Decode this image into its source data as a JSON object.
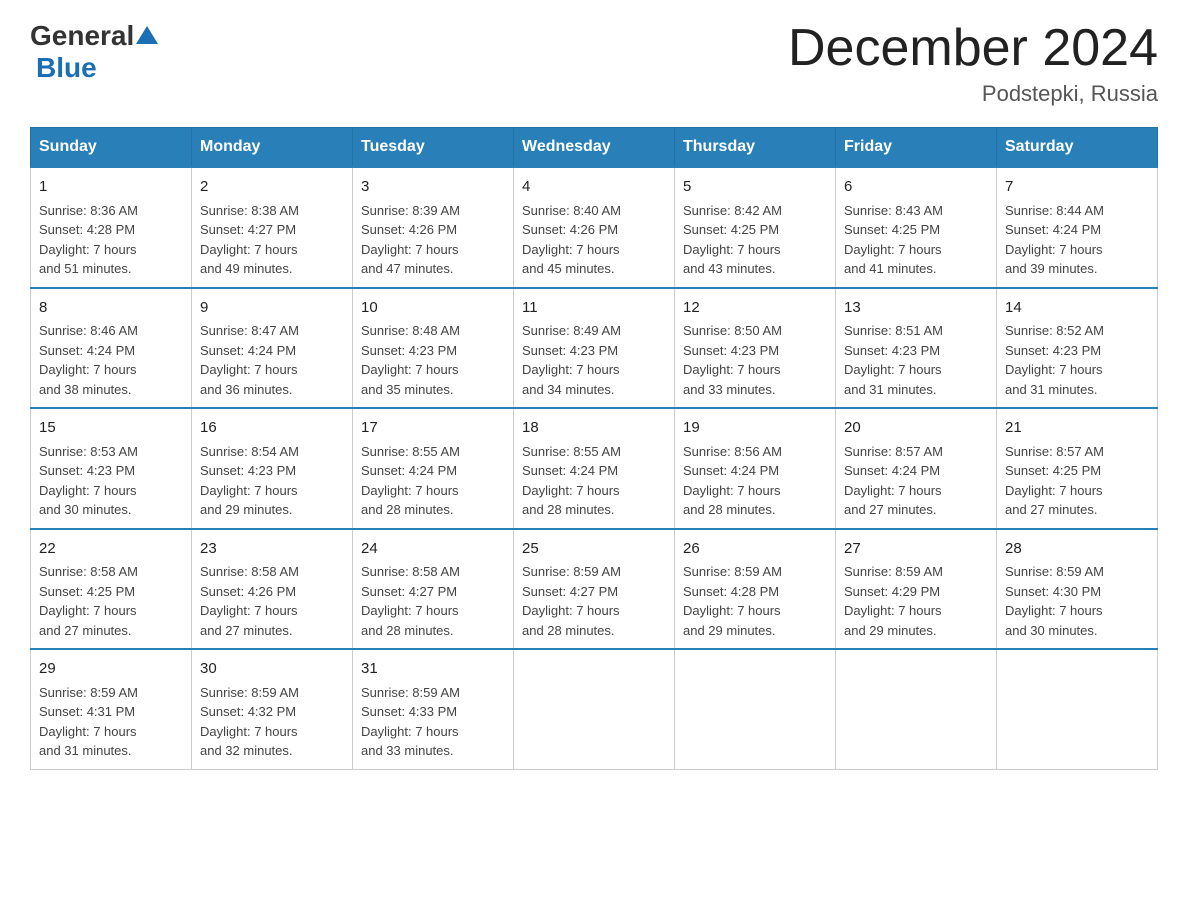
{
  "header": {
    "logo_general": "General",
    "logo_blue": "Blue",
    "month_title": "December 2024",
    "location": "Podstepki, Russia"
  },
  "days_of_week": [
    "Sunday",
    "Monday",
    "Tuesday",
    "Wednesday",
    "Thursday",
    "Friday",
    "Saturday"
  ],
  "weeks": [
    [
      {
        "num": "1",
        "info": "Sunrise: 8:36 AM\nSunset: 4:28 PM\nDaylight: 7 hours\nand 51 minutes."
      },
      {
        "num": "2",
        "info": "Sunrise: 8:38 AM\nSunset: 4:27 PM\nDaylight: 7 hours\nand 49 minutes."
      },
      {
        "num": "3",
        "info": "Sunrise: 8:39 AM\nSunset: 4:26 PM\nDaylight: 7 hours\nand 47 minutes."
      },
      {
        "num": "4",
        "info": "Sunrise: 8:40 AM\nSunset: 4:26 PM\nDaylight: 7 hours\nand 45 minutes."
      },
      {
        "num": "5",
        "info": "Sunrise: 8:42 AM\nSunset: 4:25 PM\nDaylight: 7 hours\nand 43 minutes."
      },
      {
        "num": "6",
        "info": "Sunrise: 8:43 AM\nSunset: 4:25 PM\nDaylight: 7 hours\nand 41 minutes."
      },
      {
        "num": "7",
        "info": "Sunrise: 8:44 AM\nSunset: 4:24 PM\nDaylight: 7 hours\nand 39 minutes."
      }
    ],
    [
      {
        "num": "8",
        "info": "Sunrise: 8:46 AM\nSunset: 4:24 PM\nDaylight: 7 hours\nand 38 minutes."
      },
      {
        "num": "9",
        "info": "Sunrise: 8:47 AM\nSunset: 4:24 PM\nDaylight: 7 hours\nand 36 minutes."
      },
      {
        "num": "10",
        "info": "Sunrise: 8:48 AM\nSunset: 4:23 PM\nDaylight: 7 hours\nand 35 minutes."
      },
      {
        "num": "11",
        "info": "Sunrise: 8:49 AM\nSunset: 4:23 PM\nDaylight: 7 hours\nand 34 minutes."
      },
      {
        "num": "12",
        "info": "Sunrise: 8:50 AM\nSunset: 4:23 PM\nDaylight: 7 hours\nand 33 minutes."
      },
      {
        "num": "13",
        "info": "Sunrise: 8:51 AM\nSunset: 4:23 PM\nDaylight: 7 hours\nand 31 minutes."
      },
      {
        "num": "14",
        "info": "Sunrise: 8:52 AM\nSunset: 4:23 PM\nDaylight: 7 hours\nand 31 minutes."
      }
    ],
    [
      {
        "num": "15",
        "info": "Sunrise: 8:53 AM\nSunset: 4:23 PM\nDaylight: 7 hours\nand 30 minutes."
      },
      {
        "num": "16",
        "info": "Sunrise: 8:54 AM\nSunset: 4:23 PM\nDaylight: 7 hours\nand 29 minutes."
      },
      {
        "num": "17",
        "info": "Sunrise: 8:55 AM\nSunset: 4:24 PM\nDaylight: 7 hours\nand 28 minutes."
      },
      {
        "num": "18",
        "info": "Sunrise: 8:55 AM\nSunset: 4:24 PM\nDaylight: 7 hours\nand 28 minutes."
      },
      {
        "num": "19",
        "info": "Sunrise: 8:56 AM\nSunset: 4:24 PM\nDaylight: 7 hours\nand 28 minutes."
      },
      {
        "num": "20",
        "info": "Sunrise: 8:57 AM\nSunset: 4:24 PM\nDaylight: 7 hours\nand 27 minutes."
      },
      {
        "num": "21",
        "info": "Sunrise: 8:57 AM\nSunset: 4:25 PM\nDaylight: 7 hours\nand 27 minutes."
      }
    ],
    [
      {
        "num": "22",
        "info": "Sunrise: 8:58 AM\nSunset: 4:25 PM\nDaylight: 7 hours\nand 27 minutes."
      },
      {
        "num": "23",
        "info": "Sunrise: 8:58 AM\nSunset: 4:26 PM\nDaylight: 7 hours\nand 27 minutes."
      },
      {
        "num": "24",
        "info": "Sunrise: 8:58 AM\nSunset: 4:27 PM\nDaylight: 7 hours\nand 28 minutes."
      },
      {
        "num": "25",
        "info": "Sunrise: 8:59 AM\nSunset: 4:27 PM\nDaylight: 7 hours\nand 28 minutes."
      },
      {
        "num": "26",
        "info": "Sunrise: 8:59 AM\nSunset: 4:28 PM\nDaylight: 7 hours\nand 29 minutes."
      },
      {
        "num": "27",
        "info": "Sunrise: 8:59 AM\nSunset: 4:29 PM\nDaylight: 7 hours\nand 29 minutes."
      },
      {
        "num": "28",
        "info": "Sunrise: 8:59 AM\nSunset: 4:30 PM\nDaylight: 7 hours\nand 30 minutes."
      }
    ],
    [
      {
        "num": "29",
        "info": "Sunrise: 8:59 AM\nSunset: 4:31 PM\nDaylight: 7 hours\nand 31 minutes."
      },
      {
        "num": "30",
        "info": "Sunrise: 8:59 AM\nSunset: 4:32 PM\nDaylight: 7 hours\nand 32 minutes."
      },
      {
        "num": "31",
        "info": "Sunrise: 8:59 AM\nSunset: 4:33 PM\nDaylight: 7 hours\nand 33 minutes."
      },
      {
        "num": "",
        "info": ""
      },
      {
        "num": "",
        "info": ""
      },
      {
        "num": "",
        "info": ""
      },
      {
        "num": "",
        "info": ""
      }
    ]
  ]
}
